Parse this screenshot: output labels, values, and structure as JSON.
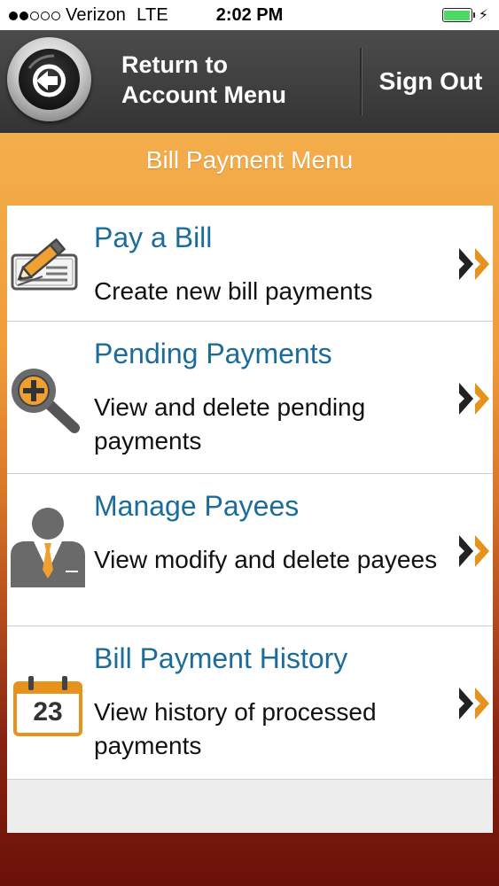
{
  "status_bar": {
    "carrier": "Verizon",
    "network": "LTE",
    "time": "2:02 PM",
    "signal_filled": 2,
    "signal_total": 5,
    "battery_level": 1.0,
    "battery_color": "#4cd964"
  },
  "header": {
    "back_label_line1": "Return to",
    "back_label_line2": "Account Menu",
    "back_icon": "back-arrow-icon",
    "sign_out_label": "Sign Out"
  },
  "page_title": "Bill Payment Menu",
  "menu": {
    "items": [
      {
        "title": "Pay a Bill",
        "description": "Create new bill payments",
        "icon": "pencil-check-icon"
      },
      {
        "title": "Pending Payments",
        "description": "View and delete pending payments",
        "icon": "magnifier-plus-icon"
      },
      {
        "title": "Manage Payees",
        "description": "View modify and delete payees",
        "icon": "person-icon"
      },
      {
        "title": "Bill Payment History",
        "description": "View history of processed payments",
        "icon": "calendar-icon",
        "calendar_day": "23"
      }
    ],
    "arrow_icon": "double-chevron-right-icon"
  },
  "colors": {
    "title_blue": "#1b6c9a",
    "accent_orange": "#e8921e",
    "header_gray": "#444444"
  }
}
